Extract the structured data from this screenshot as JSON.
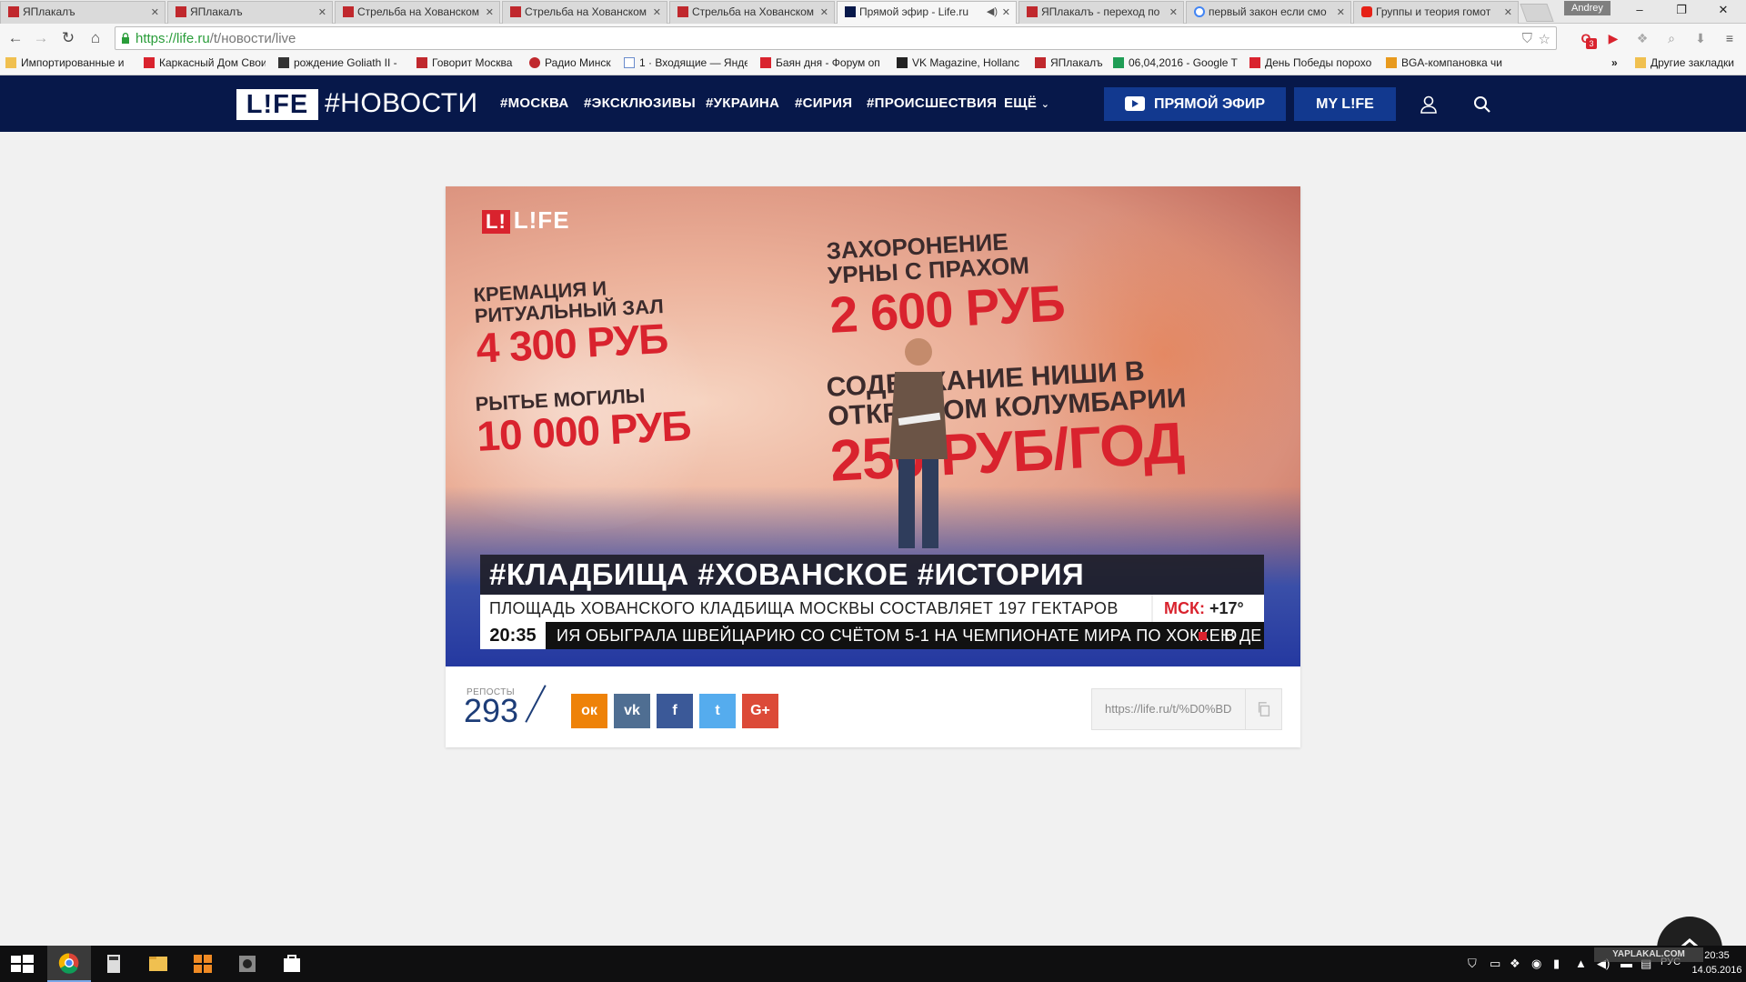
{
  "browser": {
    "tabs": [
      {
        "label": "ЯПлакалъ"
      },
      {
        "label": "ЯПлакалъ"
      },
      {
        "label": "Стрельба на Хованском"
      },
      {
        "label": "Стрельба на Хованском"
      },
      {
        "label": "Стрельба на Хованском"
      },
      {
        "label": "Прямой эфир - Life.ru"
      },
      {
        "label": "ЯПлакалъ - переход по"
      },
      {
        "label": "первый закон если смо"
      },
      {
        "label": "Группы и теория гомот"
      }
    ],
    "profile_name": "Andrey",
    "url_domain": "https://life.ru",
    "url_path": "/t/новости/live",
    "extension_badge": "3",
    "bookmarks": [
      "Импортированные и",
      "Каркасный Дом Свои",
      "рождение Goliath II -",
      "Говорит Москва",
      "Радио Минск",
      "1 · Входящие — Янде",
      "Баян дня - Форум оп",
      "VK Magazine, Hollanc",
      "ЯПлакалъ",
      "06,04,2016 - Google T",
      "День Победы порохо",
      "BGA-компановка чи"
    ],
    "bookmarks_overflow": "»",
    "other_bookmarks": "Другие закладки"
  },
  "site": {
    "logo": "L!FE",
    "section": "#НОВОСТИ",
    "nav": [
      "#МОСКВА",
      "#ЭКСКЛЮЗИВЫ",
      "#УКРАИНА",
      "#СИРИЯ",
      "#ПРОИСШЕСТВИЯ",
      "ЕЩЁ"
    ],
    "live_button": "ПРЯМОЙ ЭФИР",
    "mylife_button": "MY L!FE"
  },
  "video": {
    "channel_logo_mark": "L!",
    "channel_logo_text": "L!FE",
    "screen_lines": [
      {
        "dark": "КРЕМАЦИЯ И РИТУАЛЬНЫЙ ЗАЛ",
        "red": "4 300 РУБ"
      },
      {
        "dark": "РЫТЬЕ МОГИЛЫ",
        "red": "10 000 РУБ"
      },
      {
        "dark": "ЗАХОРОНЕНИЕ УРНЫ С ПРАХОМ",
        "red": "2 600 РУБ"
      },
      {
        "dark": "СОДЕРЖАНИЕ НИШИ В ОТКРЫТОМ КОЛУМБАРИИ",
        "red": "250 РУБ/ГОД"
      }
    ],
    "hashtags": "#КЛАДБИЩА #ХОВАНСКОЕ #ИСТОРИЯ",
    "headline": "ПЛОЩАДЬ ХОВАНСКОГО КЛАДБИЩА МОСКВЫ СОСТАВЛЯЕТ 197 ГЕКТАРОВ",
    "weather_city": "МСК:",
    "weather_temp": "+17°",
    "time": "20:35",
    "ticker": "ИЯ ОБЫГРАЛА ШВЕЙЦАРИЮ СО СЧЁТОМ 5-1 НА ЧЕМПИОНАТЕ МИРА ПО ХОККЕЮ",
    "ticker_tail": "В ДЕ"
  },
  "share": {
    "reposts_label": "РЕПОСТЫ",
    "reposts_count": "293",
    "buttons": [
      {
        "name": "odnoklassniki",
        "glyph": "ок",
        "color": "#ee8208"
      },
      {
        "name": "vkontakte",
        "glyph": "vk",
        "color": "#4f6e92"
      },
      {
        "name": "facebook",
        "glyph": "f",
        "color": "#3b5998"
      },
      {
        "name": "twitter",
        "glyph": "t",
        "color": "#55acee"
      },
      {
        "name": "google-plus",
        "glyph": "G+",
        "color": "#dc4a38"
      }
    ],
    "link": "https://life.ru/t/%D0%BD"
  },
  "taskbar": {
    "lang": "РУС",
    "time": "20:35",
    "date": "14.05.2016",
    "watermark": "YAPLAKAL.COM"
  }
}
